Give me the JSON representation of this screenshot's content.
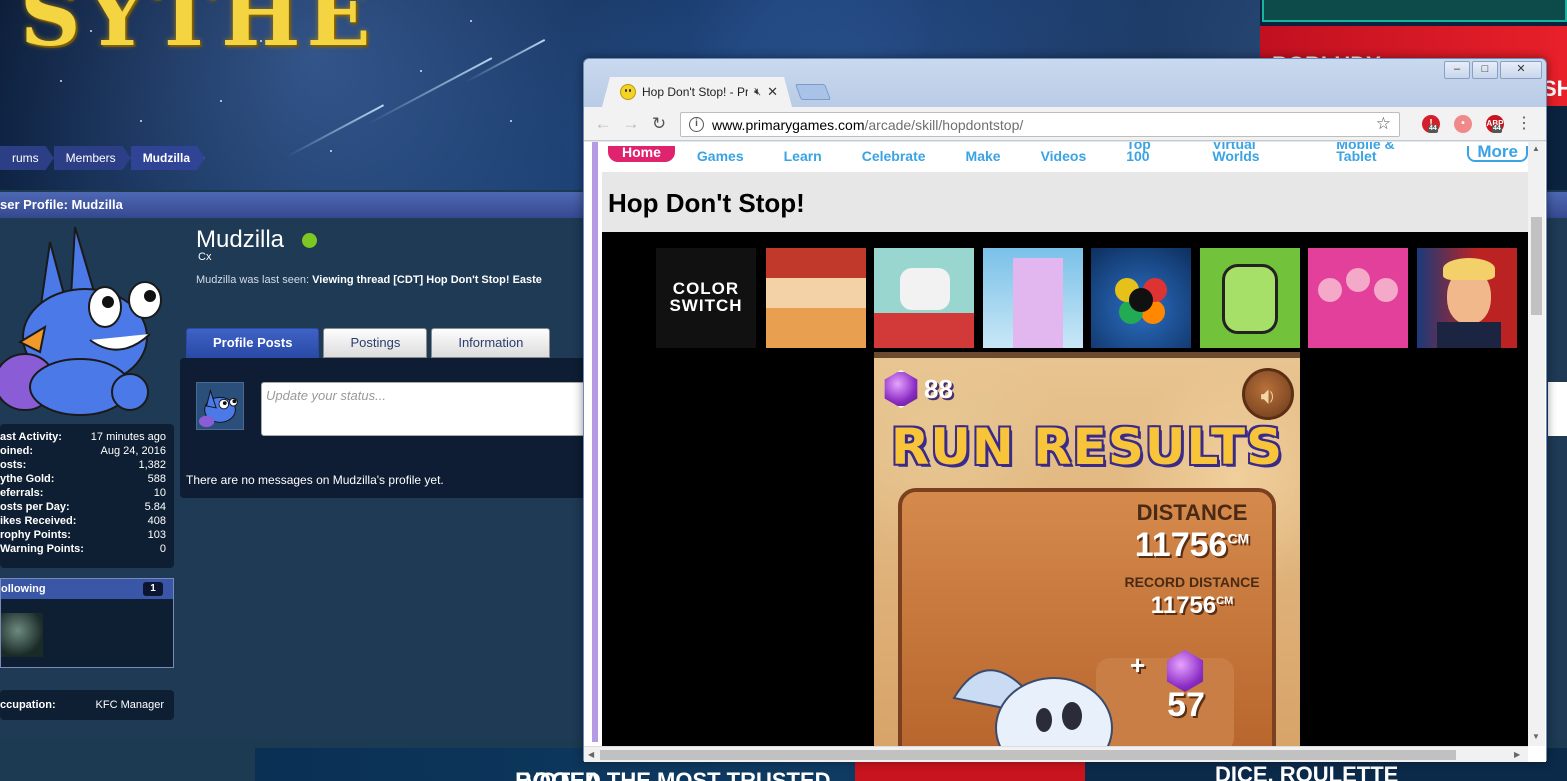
{
  "forum": {
    "logo_text": "SYTHE",
    "breadcrumb": [
      "rums",
      "Members",
      "Mudzilla"
    ],
    "profile_title": "ser Profile: Mudzilla",
    "username": "Mudzilla",
    "user_title": "Cx",
    "last_seen_label": "Mudzilla was last seen:",
    "last_seen_value": "Viewing thread [CDT] Hop Don't Stop! Easte",
    "tabs": [
      "Profile Posts",
      "Postings",
      "Information"
    ],
    "status_placeholder": "Update your status...",
    "no_messages": "There are no messages on Mudzilla's profile yet.",
    "stats": [
      {
        "key": "ast Activity:",
        "value": "17 minutes ago"
      },
      {
        "key": "oined:",
        "value": "Aug 24, 2016"
      },
      {
        "key": "osts:",
        "value": "1,382"
      },
      {
        "key": "ythe Gold:",
        "value": "588"
      },
      {
        "key": "eferrals:",
        "value": "10"
      },
      {
        "key": "osts per Day:",
        "value": "5.84"
      },
      {
        "key": "ikes Received:",
        "value": "408"
      },
      {
        "key": "rophy Points:",
        "value": "103"
      },
      {
        "key": "Warning Points:",
        "value": "0"
      }
    ],
    "following_label": "ollowing",
    "following_count": "1",
    "occupation_key": "ccupation:",
    "occupation_value": "KFC Manager",
    "ad_top_text": "BOBLUDY",
    "ad_top_right_text": "SH",
    "ad_bottom_text_1": "BOOLA",
    "ad_bottom_text_2": "VOTED THE MOST TRUSTED",
    "ad_bottom_text_3": "DICE, ROULETTE",
    "online_color": "#7cc722"
  },
  "browser": {
    "tab_title": "Hop Don't Stop! - Prim",
    "url_host": "www.primarygames.com",
    "url_path": "/arcade/skill/hopdontstop/",
    "ext_badges": [
      "44",
      "44"
    ],
    "window_buttons": [
      "–",
      "□",
      "✕"
    ]
  },
  "site": {
    "nav": [
      "Home",
      "Games",
      "Learn",
      "Celebrate",
      "Make",
      "Videos",
      "Top 100",
      "Virtual Worlds",
      "Mobile & Tablet",
      "More"
    ],
    "page_title": "Hop Don't Stop!",
    "thumb_color_switch": "COLOR SWITCH",
    "brand_pink": "#e0236f",
    "nav_blue": "#3aa3e3"
  },
  "game": {
    "gem_total": "88",
    "title": "RUN RESULTS",
    "distance_label": "DISTANCE",
    "distance_value": "11756",
    "distance_unit": "CM",
    "record_label": "RECORD DISTANCE",
    "record_value": "11756",
    "record_unit": "CM",
    "plus": "+",
    "gems_earned": "57"
  }
}
